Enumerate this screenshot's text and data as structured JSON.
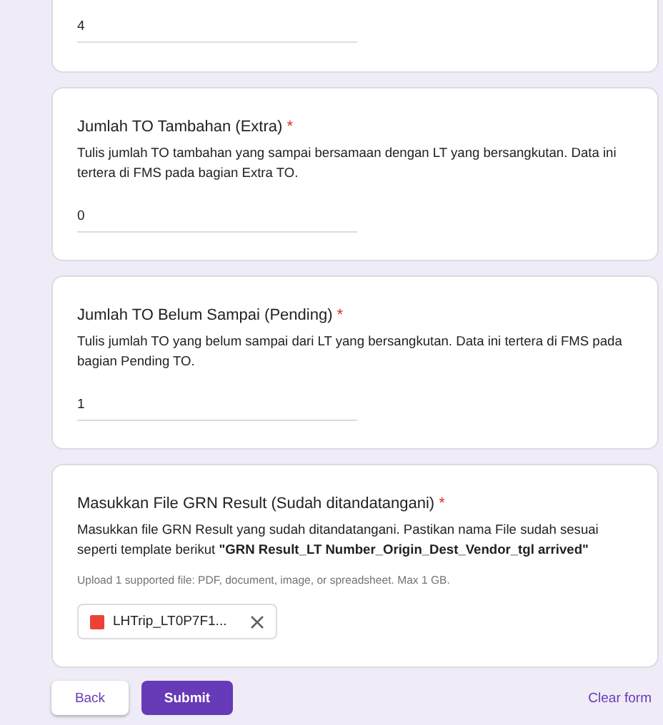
{
  "questions": [
    {
      "kind": "text",
      "answer": "4"
    },
    {
      "kind": "text",
      "title": "Jumlah TO Tambahan (Extra)",
      "required_mark": "*",
      "description": "Tulis jumlah TO tambahan yang sampai bersamaan dengan LT yang bersangkutan. Data ini  tertera di FMS pada bagian Extra TO.",
      "answer": "0"
    },
    {
      "kind": "text",
      "title": "Jumlah TO Belum Sampai (Pending)",
      "required_mark": "*",
      "description": "Tulis jumlah TO yang belum sampai dari LT yang bersangkutan. Data ini  tertera di FMS pada bagian Pending TO.",
      "answer": "1"
    },
    {
      "kind": "file",
      "title": "Masukkan File GRN Result (Sudah ditandatangani)",
      "required_mark": "*",
      "description": "Masukkan file GRN Result yang sudah ditandatangani. Pastikan nama File sudah sesuai seperti template berikut **\"GRN Result_LT Number_Origin_Dest_Vendor_tgl arrived\"**",
      "hint": "Upload 1 supported file: PDF, document, image, or spreadsheet. Max 1 GB.",
      "file": "LHTrip_LT0P7F1..."
    }
  ],
  "buttons": {
    "back": "Back",
    "submit": "Submit",
    "clear": "Clear form"
  }
}
